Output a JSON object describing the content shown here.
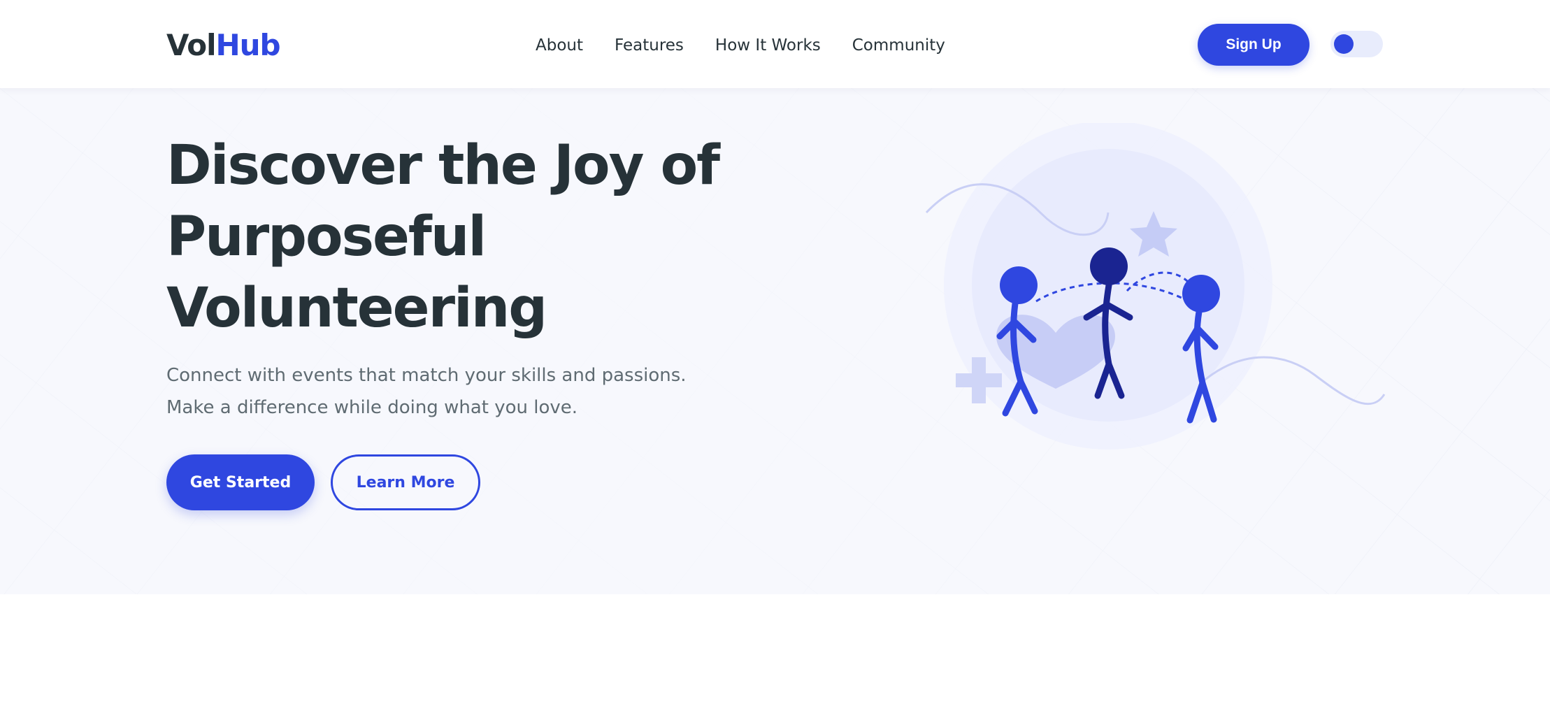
{
  "brand": {
    "logo_part1": "Vol",
    "logo_part2": "Hub",
    "accent": "#2f47e0",
    "dark": "#263238"
  },
  "nav": {
    "links": [
      "About",
      "Features",
      "How It Works",
      "Community"
    ]
  },
  "header": {
    "signup_label": "Sign Up",
    "theme_toggle": "off"
  },
  "hero": {
    "title_lines": [
      "Discover the Joy of",
      "Purposeful",
      "Volunteering"
    ],
    "subtitle_lines": [
      "Connect with events that match your skills and passions.",
      "Make a difference while doing what you love."
    ],
    "primary_button": "Get Started",
    "secondary_button": "Learn More"
  },
  "illustration": {
    "icons": [
      "stick-figure-left-icon",
      "stick-figure-center-icon",
      "stick-figure-right-icon",
      "heart-icon",
      "star-icon",
      "plus-icon"
    ]
  }
}
